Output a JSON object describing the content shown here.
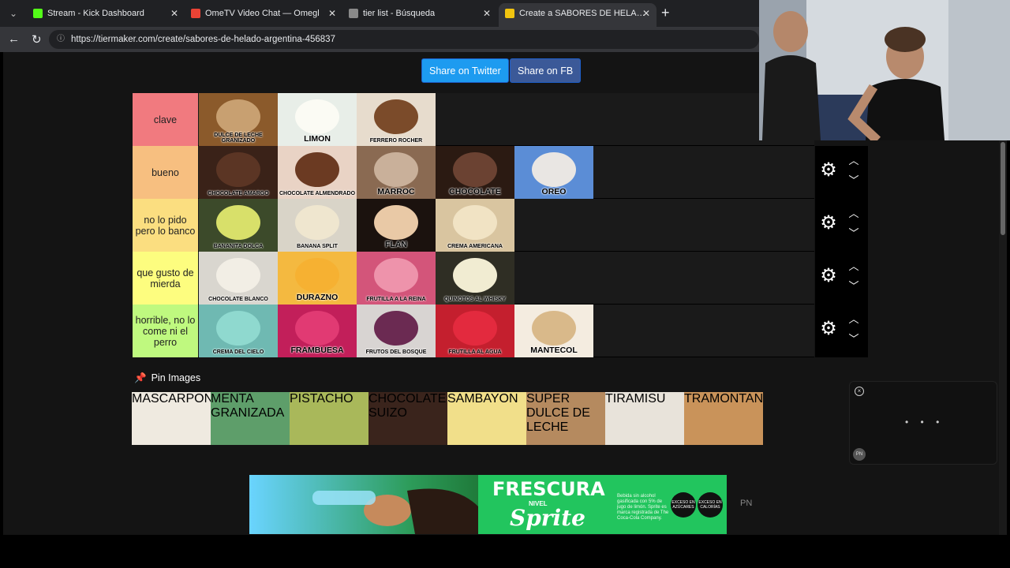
{
  "browser": {
    "tabs": [
      {
        "title": "Stream - Kick Dashboard",
        "favicon_color": "#53fc18",
        "active": false
      },
      {
        "title": "OmeTV Video Chat — Omegl",
        "favicon_color": "#ea4335",
        "active": false
      },
      {
        "title": "tier list - Búsqueda",
        "favicon_color": "#8a8a8a",
        "active": false
      },
      {
        "title": "Create a SABORES DE HELADO AR",
        "favicon_color": "#f1c40f",
        "active": true
      }
    ],
    "url": "https://tiermaker.com/create/sabores-de-helado-argentina-456837"
  },
  "share": {
    "twitter_label": "Share on Twitter",
    "fb_label": "Share on FB"
  },
  "tiers": [
    {
      "label": "clave",
      "color": "#f17a7f",
      "items": [
        {
          "caption": "DULCE DE LECHE GRANIZADO",
          "bg": "#8b5a2b",
          "scoop": "#c8a071"
        },
        {
          "caption": "LIMON",
          "bg": "#e8eee8",
          "scoop": "#fbfbf4"
        },
        {
          "caption": "FERRERO ROCHER",
          "bg": "#e7dccd",
          "scoop": "#7b4b2a"
        }
      ],
      "controls": false
    },
    {
      "label": "bueno",
      "color": "#f7bf80",
      "items": [
        {
          "caption": "CHOCOLATE AMARGO",
          "bg": "#3a2218",
          "scoop": "#5b3524"
        },
        {
          "caption": "CHOCOLATE ALMENDRADO",
          "bg": "#e9d3c5",
          "scoop": "#6b3a22"
        },
        {
          "caption": "MARROC",
          "bg": "#8a6a52",
          "scoop": "#c9b09a"
        },
        {
          "caption": "CHOCOLATE",
          "bg": "#2b1a12",
          "scoop": "#6b4232"
        },
        {
          "caption": "OREO",
          "bg": "#5b8dd6",
          "scoop": "#e9e6e3"
        }
      ],
      "controls": true
    },
    {
      "label": "no lo pido pero lo banco",
      "color": "#fbde80",
      "items": [
        {
          "caption": "BANANITA DOLCA",
          "bg": "#3c4a2a",
          "scoop": "#d8e06a"
        },
        {
          "caption": "BANANA SPLIT",
          "bg": "#d9d4c8",
          "scoop": "#efe6cf"
        },
        {
          "caption": "FLAN",
          "bg": "#1b120e",
          "scoop": "#e9c9a6"
        },
        {
          "caption": "CREMA AMERICANA",
          "bg": "#d9c5a0",
          "scoop": "#f1e3c4"
        }
      ],
      "controls": true
    },
    {
      "label": "que gusto de mierda",
      "color": "#fdfd7f",
      "items": [
        {
          "caption": "CHOCOLATE BLANCO",
          "bg": "#d9d6cf",
          "scoop": "#f2eee5"
        },
        {
          "caption": "DURAZNO",
          "bg": "#f4b940",
          "scoop": "#f6b132"
        },
        {
          "caption": "FRUTILLA A LA REINA",
          "bg": "#d3557a",
          "scoop": "#ee93ab"
        },
        {
          "caption": "QUINOTOS AL WHISKY",
          "bg": "#2f2e24",
          "scoop": "#f1ecd2"
        }
      ],
      "controls": true
    },
    {
      "label": "horrible, no lo come ni el perro",
      "color": "#bff97f",
      "items": [
        {
          "caption": "CREMA DEL CIELO",
          "bg": "#6fb9b2",
          "scoop": "#8fd9cf"
        },
        {
          "caption": "FRAMBUESA",
          "bg": "#c21f5a",
          "scoop": "#e13a73"
        },
        {
          "caption": "FRUTOS DEL BOSQUE",
          "bg": "#d8d4d2",
          "scoop": "#6b2a52"
        },
        {
          "caption": "FRUTILLA AL AGUA",
          "bg": "#c41f2e",
          "scoop": "#e32a3e"
        },
        {
          "caption": "MANTECOL",
          "bg": "#f4ece0",
          "scoop": "#d9b98a"
        }
      ],
      "controls": true
    }
  ],
  "pin": {
    "label": "Pin Images"
  },
  "pool": [
    {
      "caption": "MASCARPONE",
      "bg": "#efeae0"
    },
    {
      "caption": "MENTA GRANIZADA",
      "bg": "#5e9e6a"
    },
    {
      "caption": "PISTACHO",
      "bg": "#a9b85a"
    },
    {
      "caption": "CHOCOLATE SUIZO",
      "bg": "#3a241c"
    },
    {
      "caption": "SAMBAYON",
      "bg": "#f1df8a"
    },
    {
      "caption": "SUPER DULCE DE LECHE",
      "bg": "#b58a5f"
    },
    {
      "caption": "TIRAMISU",
      "bg": "#e8e3da"
    },
    {
      "caption": "TRAMONTANA",
      "bg": "#c9935a"
    }
  ],
  "ad": {
    "headline": "FRESCURA",
    "nivel": "NIVEL",
    "brand": "Sprite",
    "fine_print": "Bebida sin alcohol gasificada con 5% de jugo de limón. Sprite es marca registrada de The Coca-Cola Company.",
    "seal1": "EXCESO EN AZÚCARES",
    "seal2": "EXCESO EN CALORÍAS",
    "pn": "PN"
  },
  "widget": {
    "badge": "PN",
    "dots": "• • •"
  }
}
